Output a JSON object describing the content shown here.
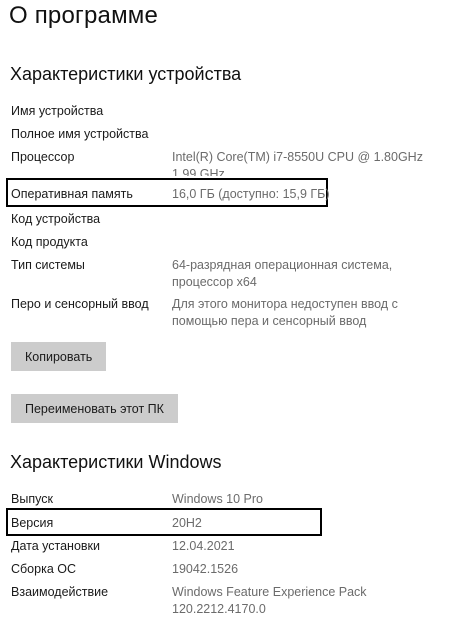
{
  "page_title": "О программе",
  "device_section": {
    "title": "Характеристики устройства",
    "rows": [
      {
        "label": "Имя устройства",
        "value": ""
      },
      {
        "label": "Полное имя устройства",
        "value": ""
      },
      {
        "label": "Процессор",
        "value": "Intel(R) Core(TM) i7-8550U CPU @ 1.80GHz 1.99 GHz"
      },
      {
        "label": "Оперативная память",
        "value": "16,0 ГБ (доступно: 15,9 ГБ)"
      },
      {
        "label": "Код устройства",
        "value": ""
      },
      {
        "label": "Код продукта",
        "value": ""
      },
      {
        "label": "Тип системы",
        "value": "64-разрядная операционная система, процессор x64"
      },
      {
        "label": "Перо и сенсорный ввод",
        "value": "Для этого монитора недоступен ввод с помощью пера и сенсорный ввод"
      }
    ],
    "copy_button": "Копировать",
    "rename_button": "Переименовать этот ПК"
  },
  "windows_section": {
    "title": "Характеристики Windows",
    "rows": [
      {
        "label": "Выпуск",
        "value": "Windows 10 Pro"
      },
      {
        "label": "Версия",
        "value": "20H2"
      },
      {
        "label": "Дата установки",
        "value": "12.04.2021"
      },
      {
        "label": "Сборка ОС",
        "value": "19042.1526"
      },
      {
        "label": "Взаимодействие",
        "value": "Windows Feature Experience Pack 120.2212.4170.0"
      }
    ]
  }
}
